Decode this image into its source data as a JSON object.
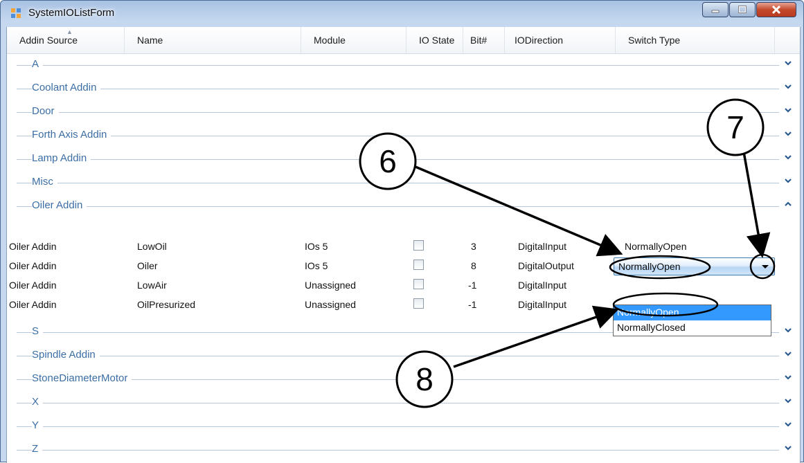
{
  "window": {
    "title": "SystemIOListForm"
  },
  "columns": [
    "Addin Source",
    "Name",
    "Module",
    "IO State",
    "Bit#",
    "IODirection",
    "Switch Type"
  ],
  "groups_before": [
    "A",
    "Coolant Addin",
    "Door",
    "Forth Axis Addin",
    "Lamp Addin",
    "Misc",
    "Oiler Addin"
  ],
  "groups_after": [
    "S",
    "Spindle Addin",
    "StoneDiameterMotor",
    "X",
    "Y",
    "Z"
  ],
  "rows": [
    {
      "source": "Oiler Addin",
      "name": "LowOil",
      "module": "IOs 5",
      "io_state": false,
      "bit": "3",
      "direction": "DigitalInput",
      "switch": "NormallyOpen"
    },
    {
      "source": "Oiler Addin",
      "name": "Oiler",
      "module": "IOs 5",
      "io_state": false,
      "bit": "8",
      "direction": "DigitalOutput",
      "switch": "NormallyOpen"
    },
    {
      "source": "Oiler Addin",
      "name": "LowAir",
      "module": "Unassigned",
      "io_state": false,
      "bit": "-1",
      "direction": "DigitalInput",
      "switch": ""
    },
    {
      "source": "Oiler Addin",
      "name": "OilPresurized",
      "module": "Unassigned",
      "io_state": false,
      "bit": "-1",
      "direction": "DigitalInput",
      "switch": ""
    }
  ],
  "dropdown": {
    "options": [
      "NormallyOpen",
      "NormallyClosed"
    ],
    "highlighted": "NormallyOpen"
  },
  "callouts": {
    "c6": "6",
    "c7": "7",
    "c8": "8"
  },
  "icons": {
    "app": "app-icon",
    "minimize": "minimize-icon",
    "maximize": "maximize-icon",
    "close": "close-icon",
    "expand": "chevron-down-icon",
    "collapse": "chevron-up-icon"
  },
  "colors": {
    "group_text": "#3b6ea5",
    "selection": "#3399ff",
    "combo_border": "#3d7bad"
  }
}
